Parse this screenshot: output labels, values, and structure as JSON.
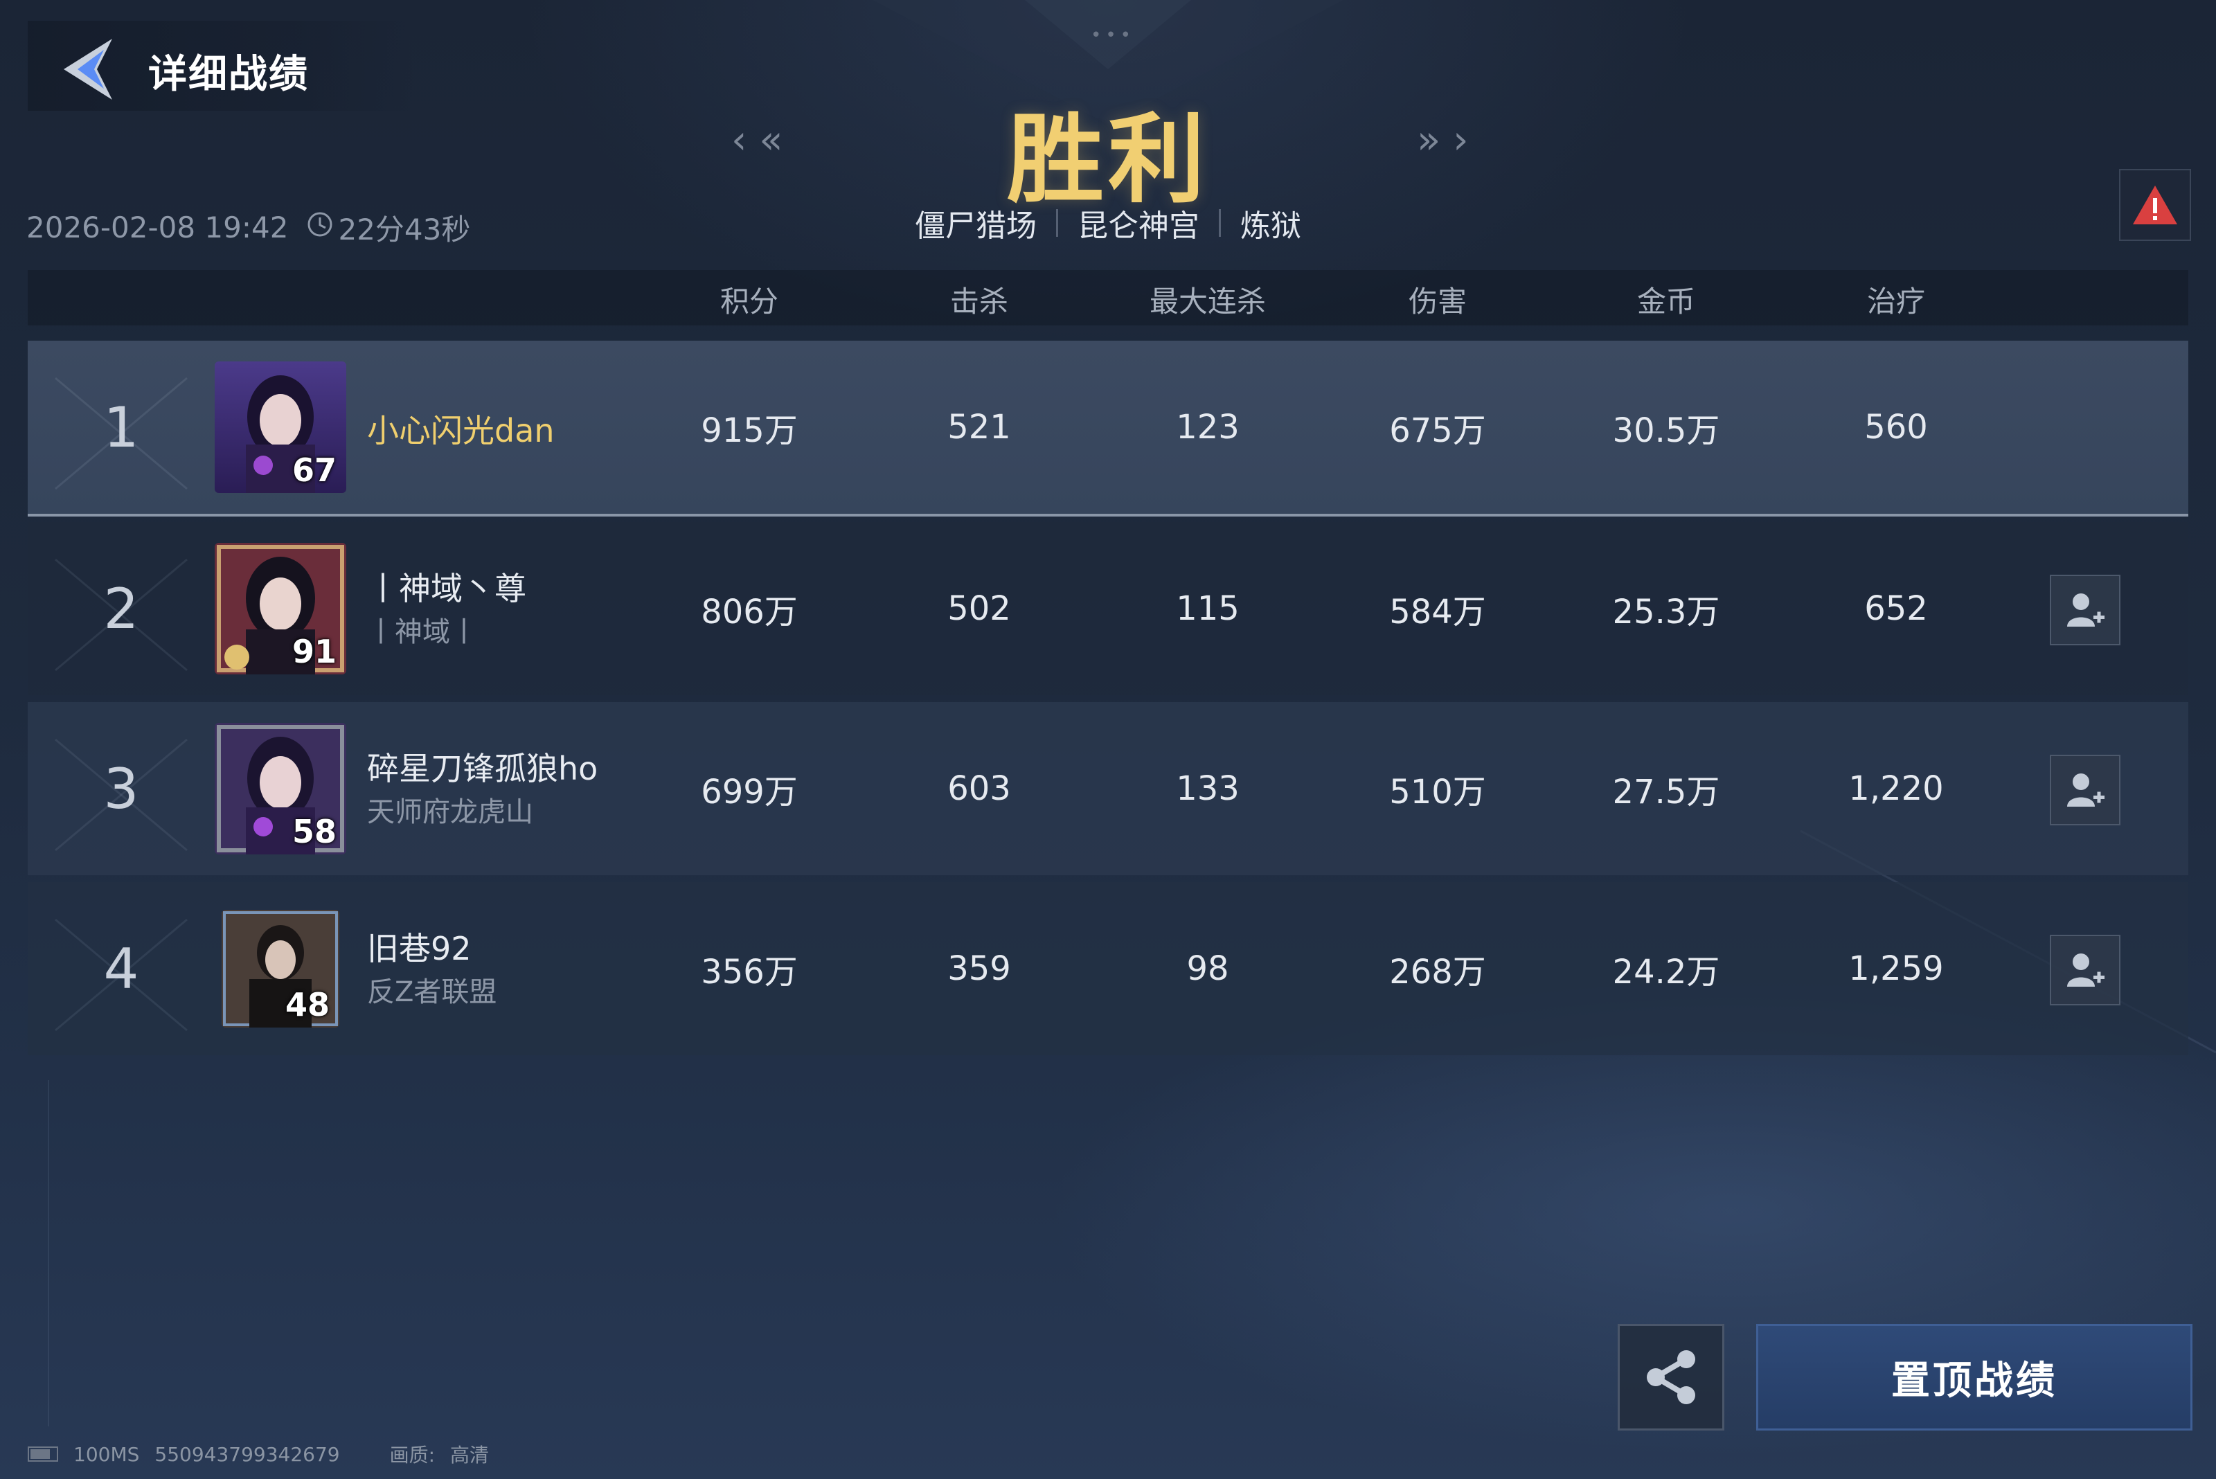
{
  "header": {
    "title": "详细战绩",
    "datetime": "2026-02-08 19:42",
    "duration": "22分43秒",
    "result": "胜利",
    "modes": [
      "僵尸猎场",
      "昆仑神宫",
      "炼狱"
    ]
  },
  "columns": [
    "积分",
    "击杀",
    "最大连杀",
    "伤害",
    "金币",
    "治疗"
  ],
  "players": [
    {
      "rank": "1",
      "name": "小心闪光dan",
      "guild": "",
      "level": "67",
      "score": "915万",
      "kills": "521",
      "max_streak": "123",
      "damage": "675万",
      "gold": "30.5万",
      "heal": "560"
    },
    {
      "rank": "2",
      "name": "丨神域丶尊",
      "guild": "丨神域丨",
      "level": "91",
      "score": "806万",
      "kills": "502",
      "max_streak": "115",
      "damage": "584万",
      "gold": "25.3万",
      "heal": "652"
    },
    {
      "rank": "3",
      "name": "碎星刀锋孤狼ho",
      "guild": "天师府龙虎山",
      "level": "58",
      "score": "699万",
      "kills": "603",
      "max_streak": "133",
      "damage": "510万",
      "gold": "27.5万",
      "heal": "1,220"
    },
    {
      "rank": "4",
      "name": "旧巷92",
      "guild": "反Z者联盟",
      "level": "48",
      "score": "356万",
      "kills": "359",
      "max_streak": "98",
      "damage": "268万",
      "gold": "24.2万",
      "heal": "1,259"
    }
  ],
  "footer": {
    "pin_label": "置顶战绩",
    "latency": "100MS",
    "match_id": "550943799342679",
    "quality_label": "画质:",
    "quality_value": "高清"
  },
  "icons": [
    "back-arrow-icon",
    "clock-icon",
    "prev-arrow-icon",
    "next-arrow-icon",
    "warning-icon",
    "add-friend-icon",
    "share-icon",
    "battery-icon"
  ],
  "colors": {
    "gold": "#f1cf72",
    "warning": "#d94040",
    "pin_button": "#2f4a78"
  }
}
